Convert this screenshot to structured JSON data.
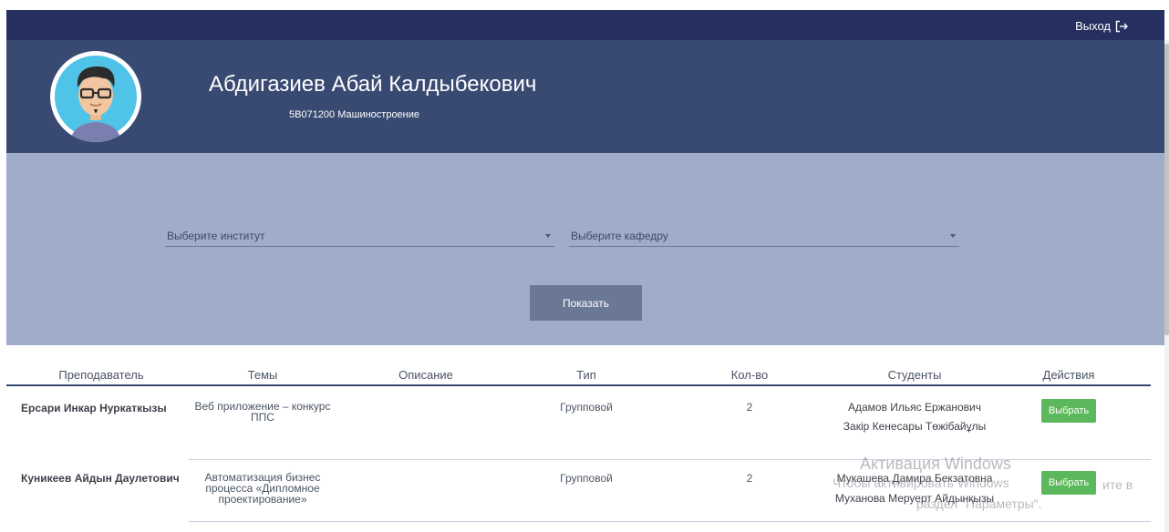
{
  "header": {
    "logout_label": "Выход"
  },
  "profile": {
    "name": "Абдигазиев Абай Калдыбекович",
    "major": "5В071200 Машиностроение"
  },
  "filters": {
    "institute_placeholder": "Выберите институт",
    "department_placeholder": "Выберите кафедру",
    "show_label": "Показать"
  },
  "table": {
    "columns": [
      "Преподаватель",
      "Темы",
      "Описание",
      "Тип",
      "Кол-во",
      "Студенты",
      "Действия"
    ],
    "rows": [
      {
        "teacher": "Ерсари Инкар Нуркаткызы",
        "topic": "Веб приложение – конкурс ППС",
        "description": "",
        "type": "Групповой",
        "count": "2",
        "students": [
          "Адамов Ильяс Ержанович",
          "Закір Кенесары Төжібайұлы"
        ],
        "action": "Выбрать"
      },
      {
        "teacher": "Куникеев Айдын Даулетович",
        "topic": "Автоматизация бизнес процесса «Дипломное проектирование»",
        "description": "",
        "type": "Групповой",
        "count": "2",
        "students": [
          "Мукашева Дамира Бекзатовна",
          "Муханова Меруерт Айдынқызы"
        ],
        "action": "Выбрать"
      }
    ]
  },
  "watermark": {
    "line1": "Активация Windows",
    "line2": "Чтобы активировать Windows",
    "line2_tail": "ите в",
    "line3": "раздел \"Параметры\"."
  },
  "colors": {
    "topbar": "#263060",
    "profile": "#394a72",
    "filter": "#9fadca",
    "show_button": "#6a7896",
    "pick_button": "#5cb85c"
  }
}
